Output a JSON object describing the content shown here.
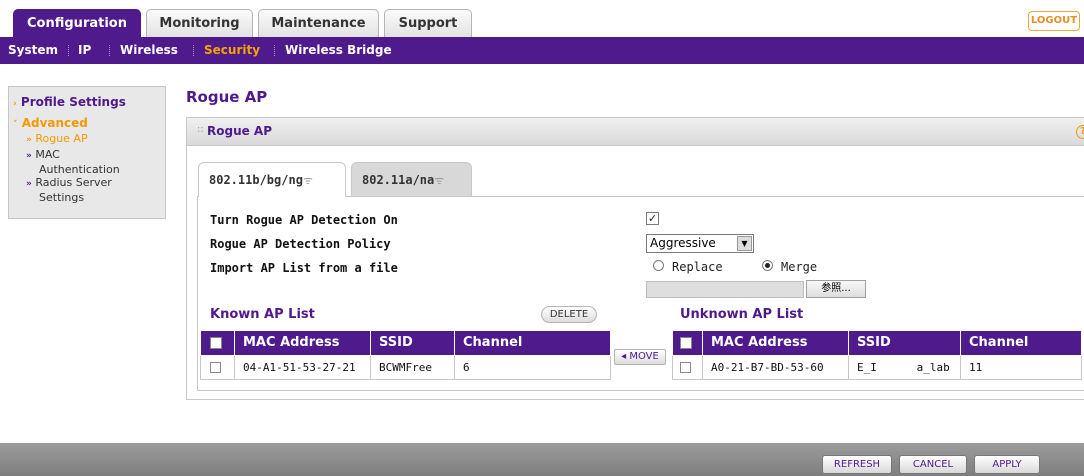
{
  "top_tabs": [
    "Configuration",
    "Monitoring",
    "Maintenance",
    "Support"
  ],
  "logout_label": "LOGOUT",
  "subnav": [
    "System",
    "IP",
    "Wireless",
    "Security",
    "Wireless Bridge"
  ],
  "sidebar": {
    "profile_settings": "Profile Settings",
    "advanced": "Advanced",
    "rogue_ap": "Rogue AP",
    "mac_auth_1": "MAC",
    "mac_auth_2": "Authentication",
    "radius_1": "Radius Server",
    "radius_2": "Settings"
  },
  "page_title": "Rogue AP",
  "panel_title": "Rogue AP",
  "help_label": "?",
  "radio_tabs": [
    "802.11b/bg/ng",
    "802.11a/na"
  ],
  "form": {
    "detection_label": "Turn Rogue AP Detection On",
    "detection_checked": "✓",
    "policy_label": "Rogue AP Detection Policy",
    "policy_value": "Aggressive",
    "import_label": "Import AP List from a file",
    "replace_label": "Replace",
    "merge_label": "Merge",
    "browse_label": "参照..."
  },
  "known": {
    "title": "Known AP List",
    "delete_label": "DELETE",
    "headers": [
      "MAC Address",
      "SSID",
      "Channel"
    ],
    "rows": [
      {
        "mac": "04-A1-51-53-27-21",
        "ssid": "BCWMFree",
        "channel": "6"
      }
    ]
  },
  "move_label": "◂ MOVE",
  "unknown": {
    "title": "Unknown AP List",
    "headers": [
      "MAC Address",
      "SSID",
      "Channel"
    ],
    "rows": [
      {
        "mac": "A0-21-B7-BD-53-60",
        "ssid": "E_I      a_lab",
        "channel": "11"
      }
    ]
  },
  "footer": {
    "refresh": "REFRESH",
    "cancel": "CANCEL",
    "apply": "APPLY"
  }
}
